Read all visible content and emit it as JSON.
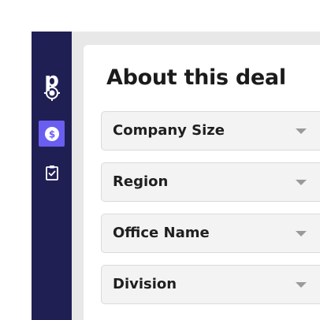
{
  "app": {
    "logo": "p"
  },
  "colors": {
    "sidebar_bg": "#201f54",
    "accent": "#6a5ef0"
  },
  "sidebar": {
    "items": [
      {
        "icon": "target-icon",
        "active": false
      },
      {
        "icon": "dollar-icon",
        "active": true
      },
      {
        "icon": "clipboard-check-icon",
        "active": false
      }
    ]
  },
  "main": {
    "title": "About this deal",
    "fields": [
      {
        "label": "Company Size",
        "icon": "chevron-down-icon"
      },
      {
        "label": "Region",
        "icon": "chevron-down-icon"
      },
      {
        "label": "Office Name",
        "icon": "chevron-down-icon"
      },
      {
        "label": "Division",
        "icon": "chevron-down-icon"
      }
    ]
  }
}
